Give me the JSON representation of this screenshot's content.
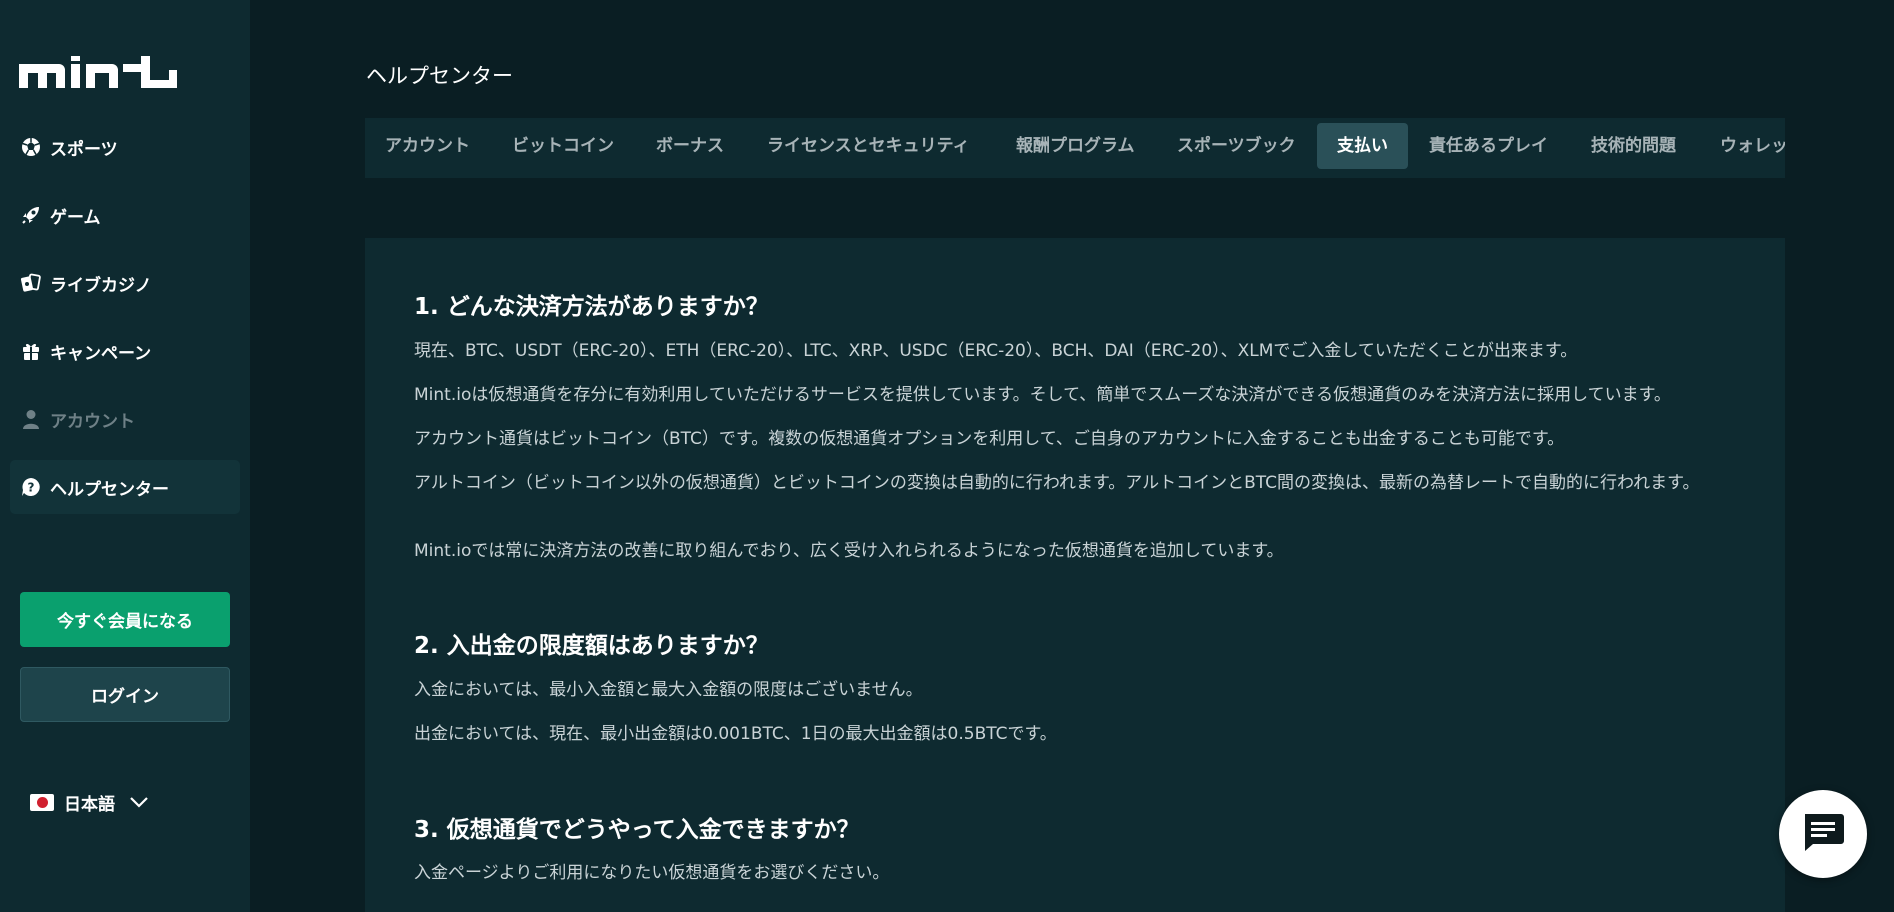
{
  "sidebar": {
    "logo": "mint",
    "nav": [
      {
        "label": "スポーツ",
        "icon": "soccer-ball-icon"
      },
      {
        "label": "ゲーム",
        "icon": "rocket-icon"
      },
      {
        "label": "ライブカジノ",
        "icon": "cards-icon"
      },
      {
        "label": "キャンペーン",
        "icon": "gift-icon"
      },
      {
        "label": "アカウント",
        "icon": "user-icon"
      },
      {
        "label": "ヘルプセンター",
        "icon": "help-icon"
      }
    ],
    "join_label": "今すぐ会員になる",
    "login_label": "ログイン",
    "language": "日本語"
  },
  "header": {
    "title": "ヘルプセンター"
  },
  "tabs": [
    "アカウント",
    "ビットコイン",
    "ボーナス",
    "ライセンスとセキュリティ",
    "報酬プログラム",
    "スポーツブック",
    "支払い",
    "責任あるプレイ",
    "技術的問題",
    "ウォレット"
  ],
  "active_tab": "支払い",
  "faq": [
    {
      "num": "1.",
      "question": "どんな決済方法がありますか？",
      "paragraphs": [
        "現在、BTC、USDT（ERC-20）、ETH（ERC-20）、LTC、XRP、USDC（ERC-20）、BCH、DAI（ERC-20）、XLMでご入金していただくことが出来ます。",
        "Mint.ioは仮想通貨を存分に有効利用していただけるサービスを提供しています。そして、簡単でスムーズな決済ができる仮想通貨のみを決済方法に採用しています。",
        "アカウント通貨はビットコイン（BTC）です。複数の仮想通貨オプションを利用して、ご自身のアカウントに入金することも出金することも可能です。",
        "アルトコイン（ビットコイン以外の仮想通貨）とビットコインの変換は自動的に行われます。アルトコインとBTC間の変換は、最新の為替レートで自動的に行われます。",
        "Mint.ioでは常に決済方法の改善に取り組んでおり、広く受け入れられるようになった仮想通貨を追加しています。"
      ]
    },
    {
      "num": "2.",
      "question": "入出金の限度額はありますか？",
      "paragraphs": [
        "入金においては、最小入金額と最大入金額の限度はございません。",
        "出金においては、現在、最小出金額は0.001BTC、1日の最大出金額は0.5BTCです。"
      ]
    },
    {
      "num": "3.",
      "question": "仮想通貨でどうやって入金できますか？",
      "paragraphs": [
        "入金ページよりご利用になりたい仮想通貨をお選びください。"
      ]
    }
  ],
  "colors": {
    "background": "#0a1e23",
    "panel": "#0e2a30",
    "accent_green": "#0aa06e",
    "active_tab": "#2a5058"
  },
  "chat_icon": "chat-icon"
}
